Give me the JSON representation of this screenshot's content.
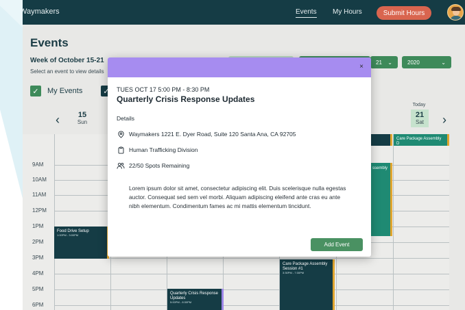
{
  "nav": {
    "brand": "Waymakers",
    "links": [
      "Events",
      "My Hours"
    ],
    "submit_label": "Submit Hours"
  },
  "page": {
    "title": "Events",
    "week": "Week of October 15-21",
    "hint": "Select an event to view details"
  },
  "filters": {
    "my_events_label": "My Events",
    "day_select": "21",
    "year_select": "2020"
  },
  "calendar": {
    "first_day": {
      "num": "15",
      "name": "Sun"
    },
    "today": {
      "label": "Today",
      "num": "21",
      "name": "Sat"
    },
    "hours": [
      "9AM",
      "10AM",
      "11AM",
      "12PM",
      "1PM",
      "2PM",
      "3PM",
      "4PM",
      "5PM",
      "6PM"
    ],
    "events": {
      "food": {
        "title": "Food Drive Setup",
        "time": "1:00PM - 3:00PM"
      },
      "crisis": {
        "title": "Quarterly Crisis Response Updates",
        "time": "5:00PM - 8:30PM"
      },
      "care": {
        "title": "Care Package Assembly Session #1",
        "time": "3:30PM - 7:30PM"
      },
      "teal_partial": "ssembly",
      "care_right": "Care Package Assembly D"
    }
  },
  "modal": {
    "when": "TUES OCT 17 5:00 PM - 8:30 PM",
    "title": "Quarterly Crisis Response Updates",
    "details_label": "Details",
    "location": "Waymakers 1221 E. Dyer Road, Suite 120 Santa Ana, CA 92705",
    "division": "Human Trafficking Division",
    "spots": "22/50 Spots Remaining",
    "description": "Lorem ipsum dolor sit amet, consectetur adipiscing elit. Duis scelerisque nulla egestas auctor. Consequat sed sem vel morbi. Aliquam adipiscing eleifend ante cras eu ante nibh elementum. Condimentum fames ac mi mattis elementum tincidunt.",
    "add_label": "Add Event",
    "close_symbol": "×"
  },
  "colors": {
    "navbar": "#153c45",
    "accent_green": "#3e8a5a",
    "submit": "#d9654f",
    "modal_header": "#a68cf0",
    "event_dark": "#153c45",
    "event_teal": "#1f8a73",
    "event_border": "#e0a52e"
  }
}
